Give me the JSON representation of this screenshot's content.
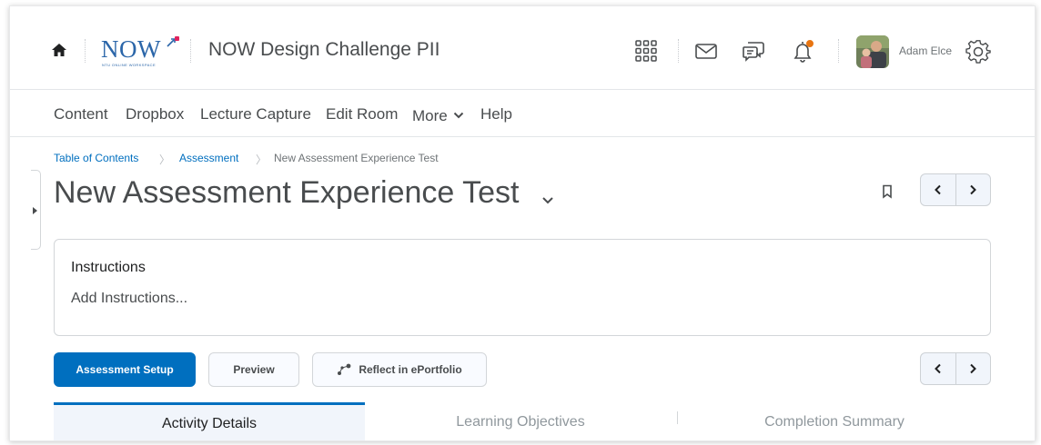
{
  "header": {
    "logo_text": "NOW",
    "logo_subtext": "NTU ONLINE WORKSPACE",
    "course_title": "NOW Design Challenge PII",
    "username": "Adam Elce",
    "icons": [
      "home-icon",
      "waffle-grid-icon",
      "mail-icon",
      "chat-bubbles-icon",
      "bell-icon",
      "avatar",
      "gear-icon"
    ],
    "notification_dot_color": "#e87511"
  },
  "navbar": {
    "items": [
      "Content",
      "Dropbox",
      "Lecture Capture",
      "Edit Room",
      "More",
      "Help"
    ]
  },
  "breadcrumb": {
    "items": [
      "Table of Contents",
      "Assessment",
      "New Assessment Experience Test"
    ]
  },
  "page": {
    "title": "New Assessment Experience Test"
  },
  "instructions": {
    "heading": "Instructions",
    "placeholder": "Add Instructions..."
  },
  "actions": {
    "primary": "Assessment Setup",
    "preview": "Preview",
    "reflect": "Reflect in ePortfolio"
  },
  "tabs": {
    "items": [
      "Activity Details",
      "Learning Objectives",
      "Completion Summary"
    ],
    "active_index": 0
  },
  "colors": {
    "accent": "#006fbf",
    "text": "#494c4e"
  }
}
